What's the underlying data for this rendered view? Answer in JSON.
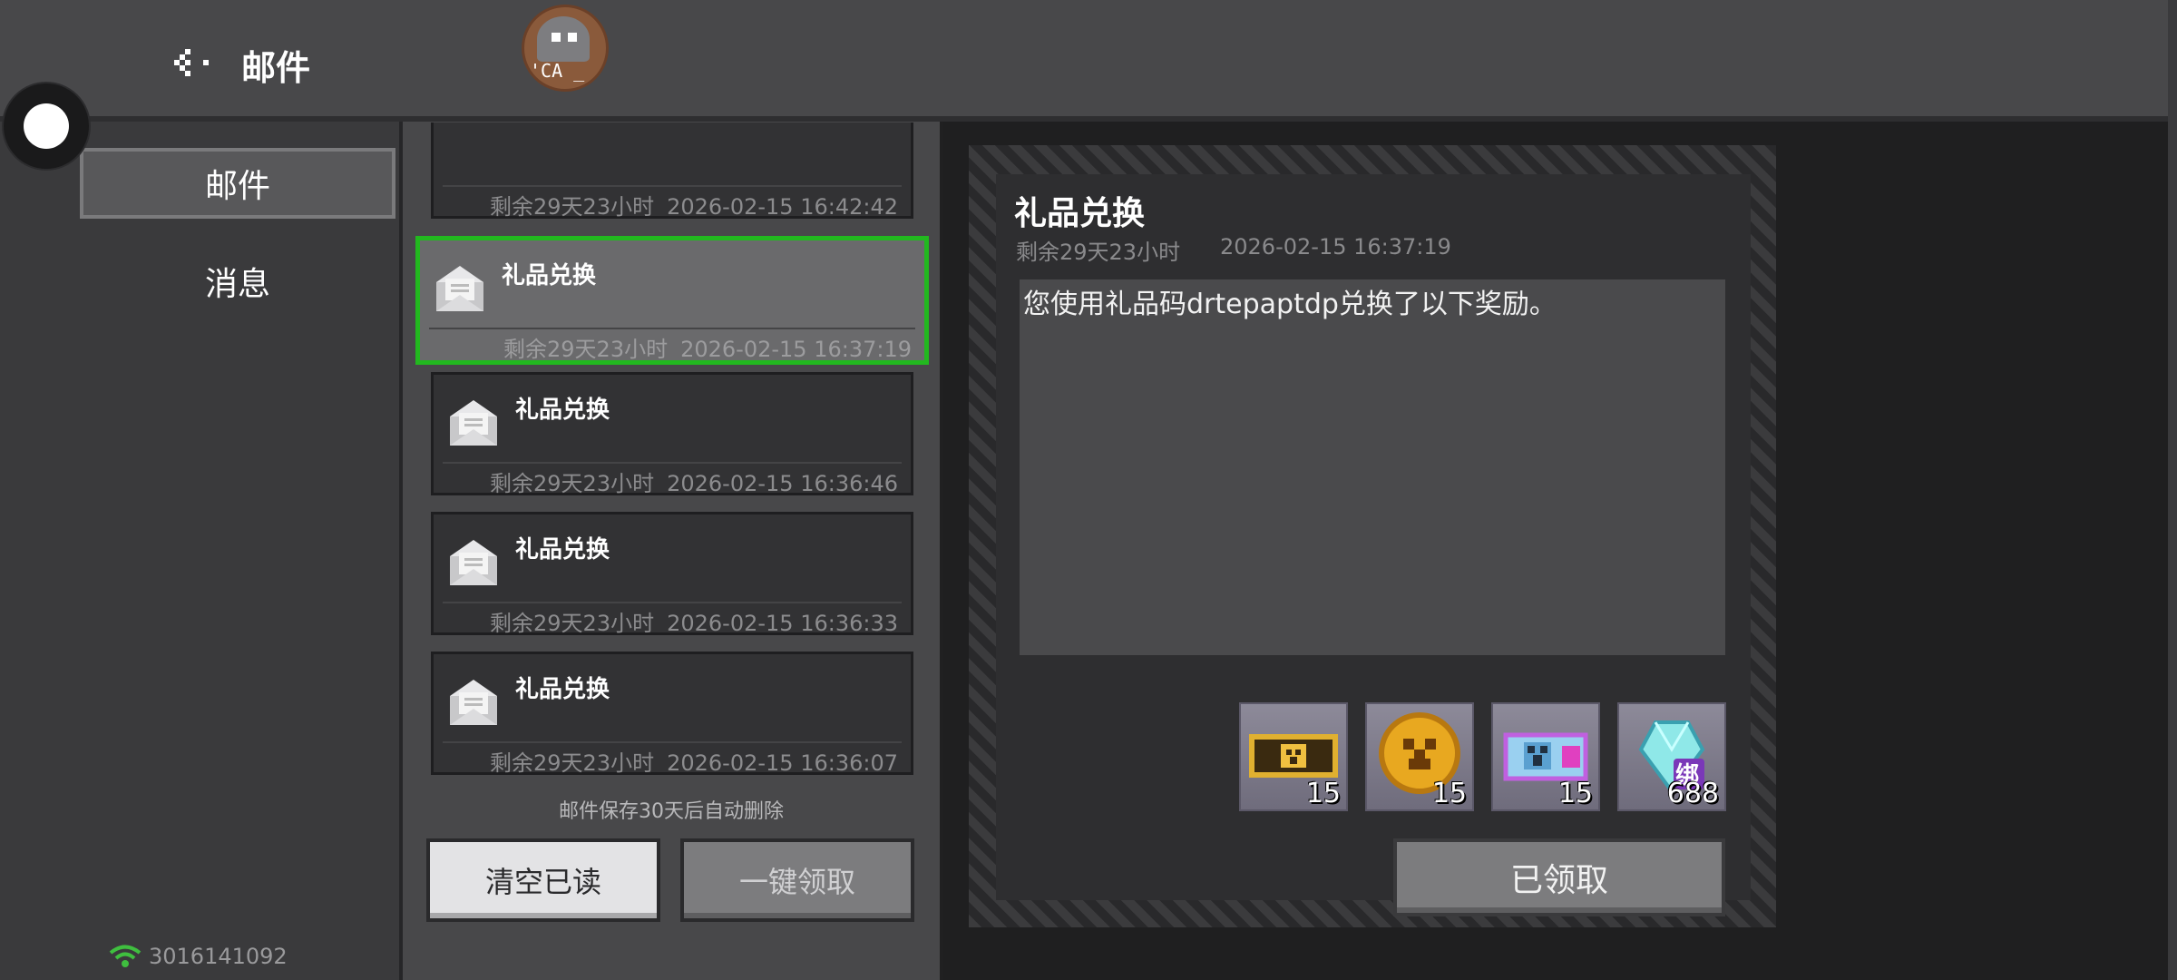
{
  "header": {
    "title": "邮件",
    "avatar_tag": "'CA _"
  },
  "sidebar": {
    "tabs": [
      {
        "label": "邮件"
      },
      {
        "label": "消息"
      }
    ],
    "user_id": "3016141092"
  },
  "mail_list": {
    "items": [
      {
        "name": "",
        "remaining": "剩余29天23小时",
        "date": "2026-02-15 16:42:42"
      },
      {
        "name": "礼品兑换",
        "remaining": "剩余29天23小时",
        "date": "2026-02-15 16:37:19"
      },
      {
        "name": "礼品兑换",
        "remaining": "剩余29天23小时",
        "date": "2026-02-15 16:36:46"
      },
      {
        "name": "礼品兑换",
        "remaining": "剩余29天23小时",
        "date": "2026-02-15 16:36:33"
      },
      {
        "name": "礼品兑换",
        "remaining": "剩余29天23小时",
        "date": "2026-02-15 16:36:07"
      }
    ],
    "auto_delete_note": "邮件保存30天后自动删除",
    "clear_read_label": "清空已读",
    "claim_all_label": "一键领取"
  },
  "detail": {
    "title": "礼品兑换",
    "remaining": "剩余29天23小时",
    "date": "2026-02-15 16:37:19",
    "body": "您使用礼品码drtepaptdp兑换了以下奖励。",
    "rewards": [
      {
        "icon": "ticket-icon",
        "count": "15"
      },
      {
        "icon": "creeper-coin-icon",
        "count": "15"
      },
      {
        "icon": "creeper-card-icon",
        "count": "15"
      },
      {
        "icon": "diamond-icon",
        "count": "688",
        "badge": "绑"
      }
    ],
    "claimed_label": "已领取"
  },
  "colors": {
    "selected_border": "#22b81f",
    "accent_wifi": "#3fbf3f"
  }
}
